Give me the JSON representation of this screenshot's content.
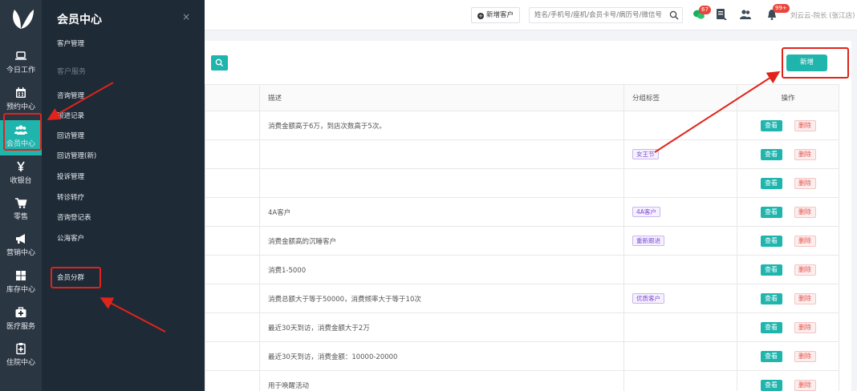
{
  "rail": {
    "items": [
      {
        "label": "今日工作",
        "icon": "laptop-icon"
      },
      {
        "label": "预约中心",
        "icon": "calendar-icon"
      },
      {
        "label": "会员中心",
        "icon": "users-icon",
        "active": true
      },
      {
        "label": "收银台",
        "icon": "yen-icon"
      },
      {
        "label": "零售",
        "icon": "cart-icon"
      },
      {
        "label": "营销中心",
        "icon": "megaphone-icon"
      },
      {
        "label": "库存中心",
        "icon": "grid-icon"
      },
      {
        "label": "医疗服务",
        "icon": "medkit-icon"
      },
      {
        "label": "住院中心",
        "icon": "clipboard-icon"
      }
    ]
  },
  "flyout": {
    "title": "会员中心",
    "close": "×",
    "links": {
      "customer_mgmt": "客户管理",
      "section_service": "客户服务",
      "consult_mgmt": "咨询管理",
      "followup_record": "跟进记录",
      "revisit_mgmt": "回访管理",
      "revisit_mgmt_new": "回访管理(新)",
      "complaint_mgmt": "投诉管理",
      "transfer": "转诊转疗",
      "consult_log": "咨询登记表",
      "public_customer": "公海客户",
      "member_group": "会员分群"
    }
  },
  "topbar": {
    "add_customer": "新增客户",
    "search_placeholder": "姓名/手机号/座机/会员卡号/病历号/微信号",
    "badge_msg": "67",
    "badge_notify": "99+",
    "user": "刘云云-院长 (张江店)"
  },
  "card": {
    "new_button": "新增"
  },
  "table": {
    "headers": {
      "name": "",
      "desc": "描述",
      "tag": "分组标签",
      "ops": "操作"
    },
    "view_label": "查看",
    "delete_label": "删除",
    "rows": [
      {
        "desc": "消费金额高于6万，到店次数高于5次。",
        "tag": ""
      },
      {
        "desc": "",
        "tag": "女王节"
      },
      {
        "desc": "",
        "tag": ""
      },
      {
        "desc": "4A客户",
        "tag": "4A客户"
      },
      {
        "desc": "消费金额高的沉睡客户",
        "tag": "重新跟进"
      },
      {
        "desc": "消费1-5000",
        "tag": ""
      },
      {
        "desc": "消费总额大于等于50000，消费频率大于等于10次",
        "tag": "优质客户"
      },
      {
        "desc": "最近30天到访，消费金额大于2万",
        "tag": ""
      },
      {
        "desc": "最近30天到访，消费金额：10000-20000",
        "tag": ""
      },
      {
        "desc": "用于唤醒活动",
        "tag": ""
      }
    ]
  },
  "colors": {
    "accent": "#1fb5ad",
    "rail": "#2b3643",
    "flyout": "#1e2a36",
    "annotation": "#e0241b"
  }
}
